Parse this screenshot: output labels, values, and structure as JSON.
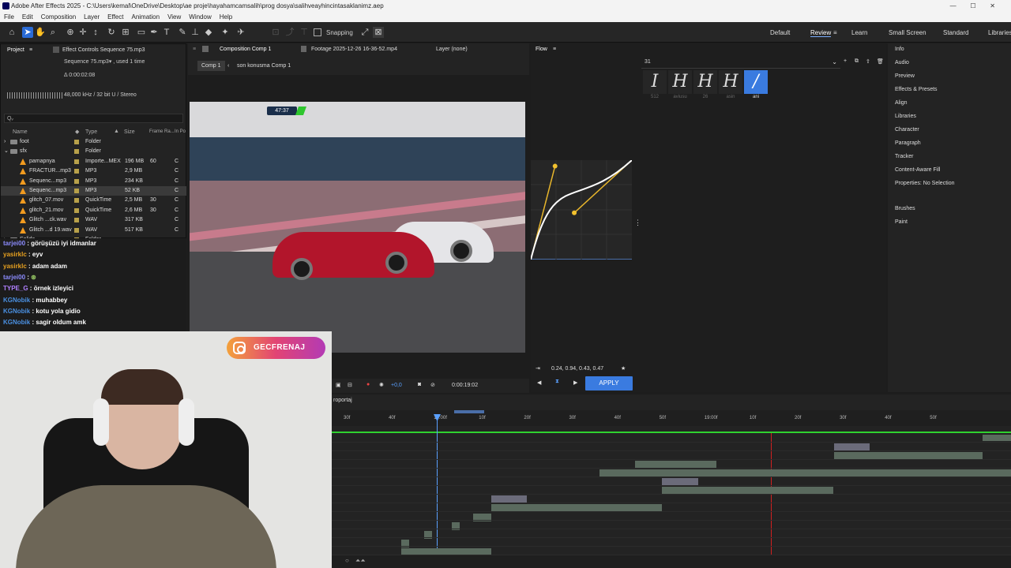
{
  "window": {
    "title": "Adobe After Effects 2025 - C:\\Users\\kemal\\OneDrive\\Desktop\\ae proje\\hayahamcamsalih\\prog dosya\\salihveayhincintasaklanimz.aep"
  },
  "menu": [
    "File",
    "Edit",
    "Composition",
    "Layer",
    "Effect",
    "Animation",
    "View",
    "Window",
    "Help"
  ],
  "toolbar": {
    "snapping_label": "Snapping"
  },
  "workspaces": [
    "Default",
    "Review",
    "Learn",
    "Small Screen",
    "Standard",
    "Libraries"
  ],
  "project": {
    "tab": "Project",
    "effect_controls": "Effect Controls Sequence 75.mp3",
    "item_name": "Sequence 75.mp3▾ , used 1 time",
    "item_duration": "Δ 0:00:02:08",
    "item_audio": "48,000 kHz / 32 bit U / Stereo",
    "search_placeholder": "Qᵥ",
    "columns": [
      "Name",
      "Type",
      "Size",
      "Frame Ra...",
      "In Po"
    ],
    "rows": [
      {
        "name": "foot",
        "type": "Folder",
        "size": "",
        "fps": "",
        "in": "",
        "kind": "folder",
        "selected": false
      },
      {
        "name": "sfx",
        "type": "Folder",
        "size": "",
        "fps": "",
        "in": "",
        "kind": "folder",
        "selected": false
      },
      {
        "name": "pamapnya",
        "type": "Importe...MEX",
        "size": "196 MB",
        "fps": "60",
        "in": "C",
        "kind": "file",
        "selected": false
      },
      {
        "name": "FRACTUR...mp3",
        "type": "MP3",
        "size": "2,9 MB",
        "fps": "",
        "in": "C",
        "kind": "file",
        "selected": false
      },
      {
        "name": "Sequenc...mp3",
        "type": "MP3",
        "size": "234 KB",
        "fps": "",
        "in": "C",
        "kind": "file",
        "selected": false
      },
      {
        "name": "Sequenc...mp3",
        "type": "MP3",
        "size": "52 KB",
        "fps": "",
        "in": "C",
        "kind": "file",
        "selected": true
      },
      {
        "name": "glitch_07.mov",
        "type": "QuickTime",
        "size": "2,5 MB",
        "fps": "30",
        "in": "C",
        "kind": "file",
        "selected": false
      },
      {
        "name": "glitch_21.mov",
        "type": "QuickTime",
        "size": "2,6 MB",
        "fps": "30",
        "in": "C",
        "kind": "file",
        "selected": false
      },
      {
        "name": "Glitch ...ck.wav",
        "type": "WAV",
        "size": "317 KB",
        "fps": "",
        "in": "C",
        "kind": "file",
        "selected": false
      },
      {
        "name": "Glitch ...d 19.wav",
        "type": "WAV",
        "size": "517 KB",
        "fps": "",
        "in": "C",
        "kind": "file",
        "selected": false
      },
      {
        "name": "Solids",
        "type": "Folder",
        "size": "",
        "fps": "",
        "in": "",
        "kind": "folder",
        "selected": false
      }
    ]
  },
  "chat": [
    {
      "user": "tarjei00",
      "color": "#8c8cff",
      "msg": "görüşüzü iyi idmanlar"
    },
    {
      "user": "yasirklc",
      "color": "#e6a020",
      "msg": "eyv"
    },
    {
      "user": "yasirklc",
      "color": "#e6a020",
      "msg": "adam adam"
    },
    {
      "user": "tarjei00",
      "color": "#8c8cff",
      "msg": ""
    },
    {
      "user": "TYPE_G",
      "color": "#b080ff",
      "msg": "örnek izleyici"
    },
    {
      "user": "KGNobik",
      "color": "#4a90e2",
      "msg": "muhabbey"
    },
    {
      "user": "KGNobik",
      "color": "#4a90e2",
      "msg": "kotu yola gidio"
    },
    {
      "user": "KGNobik",
      "color": "#4a90e2",
      "msg": "sagir oldum amk"
    }
  ],
  "composition": {
    "tab": "Composition Comp 1",
    "footage_tab": "Footage 2025-12-26 16-36-52.mp4",
    "layer_tab": "Layer (none)",
    "breadcrumb": [
      "Comp 1",
      "son konusma Comp 1"
    ],
    "overlay_time": "47:37",
    "zoom": "+0,0",
    "timecode": "0:00:19:02"
  },
  "flow": {
    "tab": "Flow",
    "preset_count": "31",
    "presets": [
      {
        "glyph": "I",
        "label": "512",
        "active": false
      },
      {
        "glyph": "H",
        "label": "aviusu",
        "active": false
      },
      {
        "glyph": "H",
        "label": "26",
        "active": false
      },
      {
        "glyph": "H",
        "label": "asin",
        "active": false
      },
      {
        "glyph": "/",
        "label": "ani",
        "active": true
      }
    ],
    "bezier": "0.24, 0.94, 0.43, 0.47",
    "apply_label": "APPLY"
  },
  "right_panel": [
    "Info",
    "Audio",
    "Preview",
    "Effects & Presets",
    "Align",
    "Libraries",
    "Character",
    "Paragraph",
    "Tracker",
    "Content-Aware Fill",
    "Properties: No Selection",
    "Brushes",
    "Paint"
  ],
  "timeline": {
    "layer_name": "roportaj",
    "ticks": [
      "30f",
      "40f",
      "18:00f",
      "10f",
      "20f",
      "30f",
      "40f",
      "50f",
      "19:00f",
      "10f",
      "20f",
      "30f",
      "40f",
      "50f"
    ]
  },
  "webcam": {
    "instagram_handle": "GECFRENAJ"
  },
  "colors": {
    "accent": "#3a7be0",
    "timeline_green": "#2fd12f",
    "playhead_red": "#d02020",
    "bezier_curve": "#f2c12e"
  }
}
